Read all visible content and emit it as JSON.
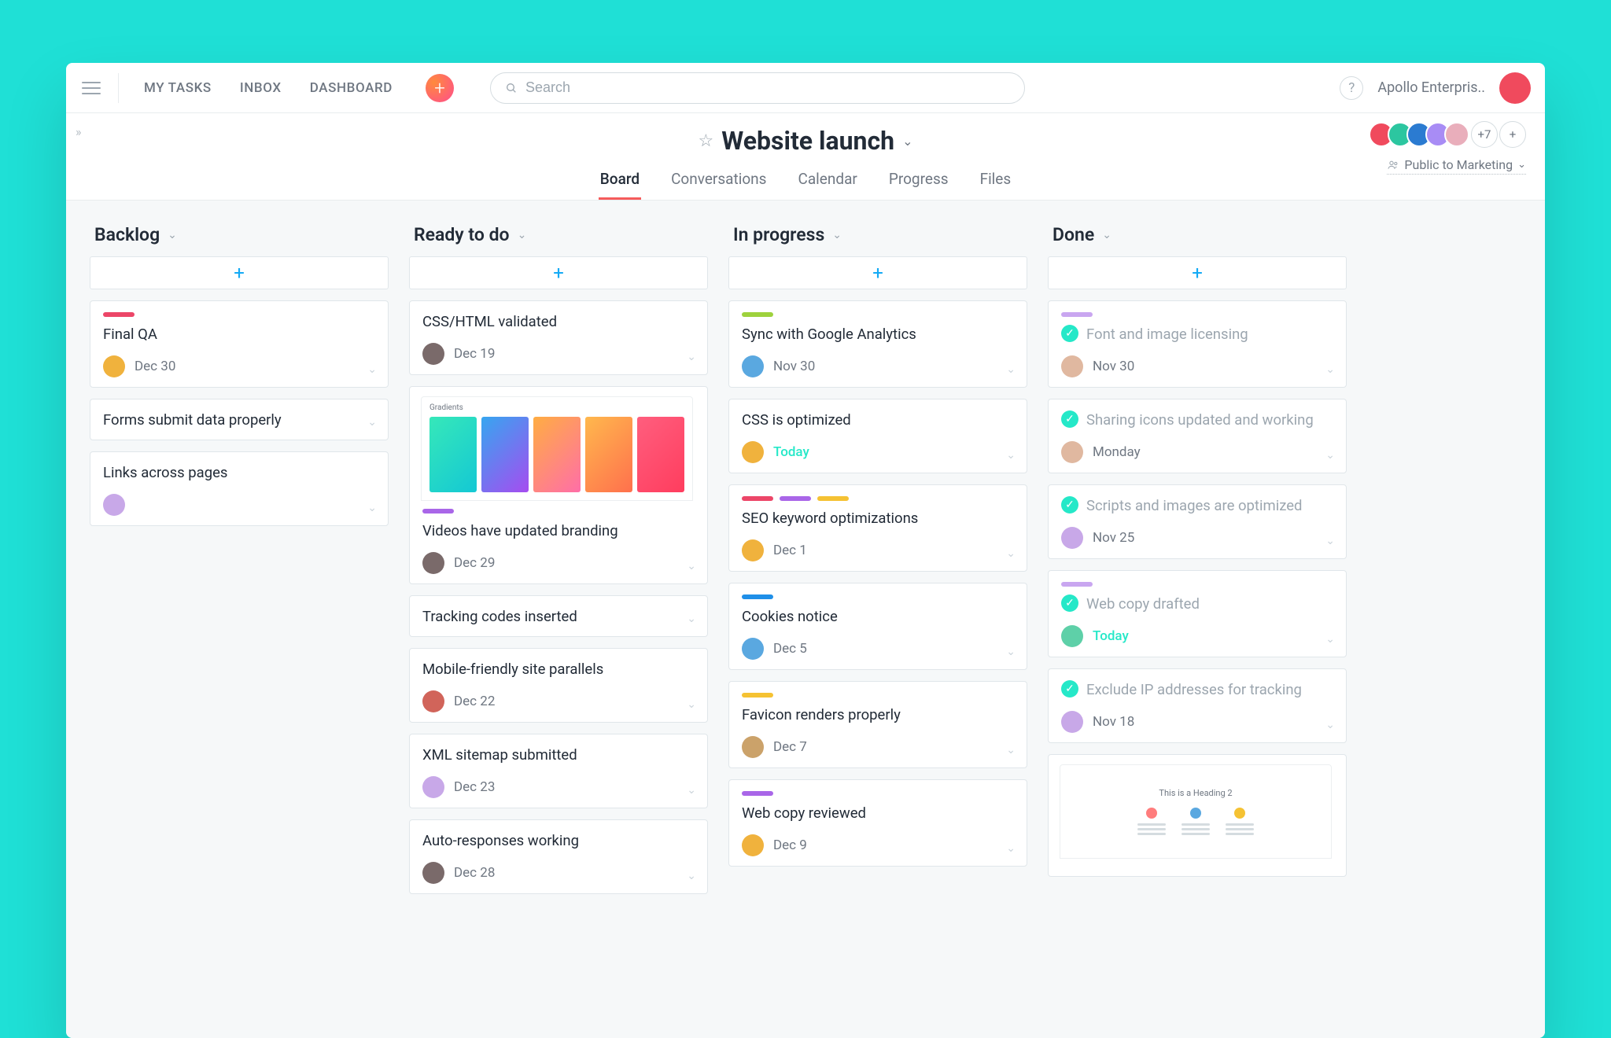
{
  "topnav": {
    "links": [
      "MY TASKS",
      "INBOX",
      "DASHBOARD"
    ],
    "add_icon": "plus",
    "search_placeholder": "Search",
    "help_label": "?",
    "workspace": "Apollo Enterpris..",
    "user_avatar_color": "#f04a5d"
  },
  "project": {
    "title": "Website launch",
    "star": "☆",
    "tabs": [
      "Board",
      "Conversations",
      "Calendar",
      "Progress",
      "Files"
    ],
    "active_tab": "Board",
    "members_extra": "+7",
    "add_member": "+",
    "privacy": "Public to Marketing",
    "member_avatar_colors": [
      "#f04a5d",
      "#2cc6a0",
      "#2b7bd1",
      "#a88cf5",
      "#e9aebb"
    ]
  },
  "columns": [
    {
      "title": "Backlog",
      "cards": [
        {
          "tags": [
            "#ec4668"
          ],
          "title": "Final QA",
          "avatar": "#f0b23d",
          "date": "Dec 30"
        },
        {
          "tags": [],
          "title": "Forms submit data properly"
        },
        {
          "tags": [],
          "title": "Links across pages",
          "avatar": "#c8a8e8"
        }
      ]
    },
    {
      "title": "Ready to do",
      "cards": [
        {
          "tags": [],
          "title": "CSS/HTML validated",
          "avatar": "#7a6a6a",
          "date": "Dec 19"
        },
        {
          "thumb": true,
          "tags": [
            "#a966e8"
          ],
          "title": "Videos have updated branding",
          "avatar": "#7a6a6a",
          "date": "Dec 29"
        },
        {
          "tags": [],
          "title": "Tracking codes inserted"
        },
        {
          "tags": [],
          "title": "Mobile-friendly site parallels",
          "avatar": "#d1645a",
          "date": "Dec 22"
        },
        {
          "tags": [],
          "title": "XML sitemap submitted",
          "avatar": "#c8a8e8",
          "date": "Dec 23"
        },
        {
          "tags": [],
          "title": "Auto-responses working",
          "avatar": "#7a6a6a",
          "date": "Dec 28"
        }
      ]
    },
    {
      "title": "In progress",
      "cards": [
        {
          "tags": [
            "#9ed23d"
          ],
          "title": "Sync with Google Analytics",
          "avatar": "#5aa8e0",
          "date": "Nov 30"
        },
        {
          "tags": [],
          "title": "CSS is optimized",
          "avatar": "#f0b23d",
          "date": "Today",
          "today": true
        },
        {
          "tags": [
            "#ec4668",
            "#a966e8",
            "#f5c233"
          ],
          "title": "SEO keyword optimizations",
          "avatar": "#f0b23d",
          "date": "Dec 1"
        },
        {
          "tags": [
            "#1f8fe8"
          ],
          "title": "Cookies notice",
          "avatar": "#5aa8e0",
          "date": "Dec 5"
        },
        {
          "tags": [
            "#f5c233"
          ],
          "title": "Favicon renders properly",
          "avatar": "#cba26a",
          "date": "Dec 7"
        },
        {
          "tags": [
            "#a966e8"
          ],
          "title": "Web copy reviewed",
          "avatar": "#f0b23d",
          "date": "Dec 9"
        }
      ]
    },
    {
      "title": "Done",
      "cards": [
        {
          "done": true,
          "tags": [
            "#c9a6f0"
          ],
          "title": "Font and image licensing",
          "avatar": "#e0b8a0",
          "date": "Nov 30"
        },
        {
          "done": true,
          "tags": [],
          "title": "Sharing icons updated and working",
          "avatar": "#e0b8a0",
          "date": "Monday"
        },
        {
          "done": true,
          "tags": [],
          "title": "Scripts and images are optimized",
          "avatar": "#c8a8e8",
          "date": "Nov 25"
        },
        {
          "done": true,
          "tags": [
            "#c9a6f0"
          ],
          "title": "Web copy drafted",
          "avatar": "#5ed0a8",
          "date": "Today",
          "today": true
        },
        {
          "done": true,
          "tags": [],
          "title": "Exclude IP addresses for tracking",
          "avatar": "#c8a8e8",
          "date": "Nov 18"
        },
        {
          "preview": true,
          "title": "This is a Heading 2"
        }
      ]
    }
  ],
  "thumb": {
    "label": "Gradients",
    "swatches": [
      "linear-gradient(135deg,#36e8b9,#14c8d4)",
      "linear-gradient(135deg,#36a6f0,#a64cf0)",
      "linear-gradient(135deg,#ffad42,#ff6ea8)",
      "linear-gradient(135deg,#ffb84d,#ff704d)",
      "linear-gradient(135deg,#ff5e7e,#ff3d5e)"
    ]
  },
  "preview_dots": [
    "#ff7d7d",
    "#5aa8e0",
    "#f5c233"
  ]
}
